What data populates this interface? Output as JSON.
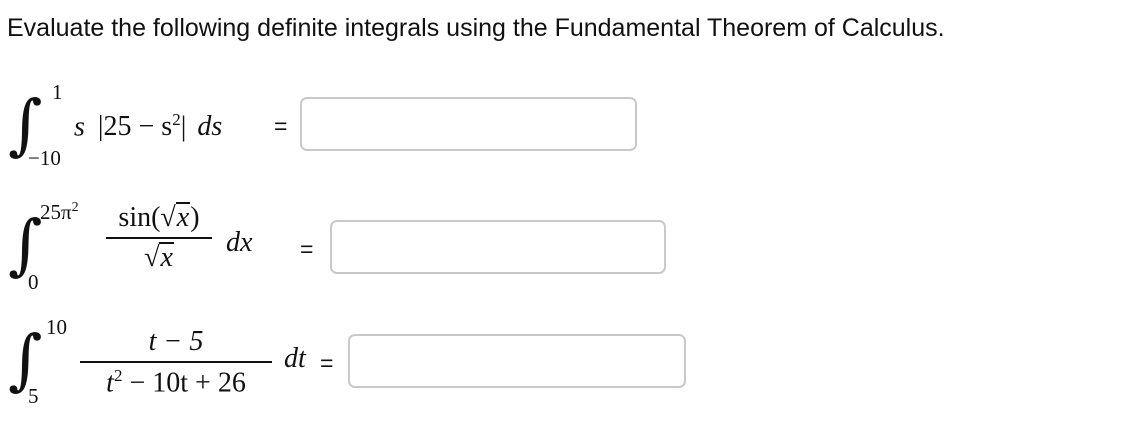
{
  "instructions": "Evaluate the following definite integrals using the Fundamental Theorem of Calculus.",
  "problems": [
    {
      "upper": "1",
      "lower": "−10",
      "integrand_s": "s",
      "integrand_abs_open": "|25 − s",
      "integrand_exp": "2",
      "integrand_abs_close": "|",
      "differential": "ds",
      "equals": "=",
      "answer": ""
    },
    {
      "upper_base": "25π",
      "upper_exp": "2",
      "lower": "0",
      "num_sin": "sin(",
      "num_radicand": "x",
      "num_close": ")",
      "den_radicand": "x",
      "differential": "dx",
      "equals": "=",
      "answer": ""
    },
    {
      "upper": "10",
      "lower": "5",
      "numerator": "t − 5",
      "den_t": "t",
      "den_exp": "2",
      "den_rest": " − 10t + 26",
      "differential": "dt",
      "equals": "=",
      "answer": ""
    }
  ]
}
